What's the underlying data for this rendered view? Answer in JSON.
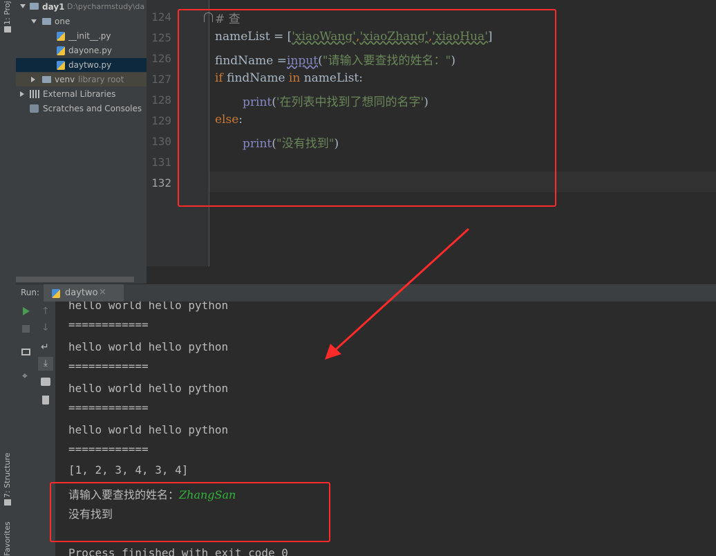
{
  "tool_windows": {
    "project_label": "1: Proj",
    "structure_label": "7: Structure",
    "favorites_label": "Favorites"
  },
  "project_tree": {
    "root_name": "day1",
    "root_path": "D:\\pycharmstudy\\da",
    "folder_one": "one",
    "files": [
      "__init__.py",
      "dayone.py",
      "daytwo.py"
    ],
    "venv_name": "venv",
    "venv_hint": "library root",
    "external_libraries": "External Libraries",
    "scratches": "Scratches and Consoles"
  },
  "editor": {
    "line_numbers": [
      "124",
      "125",
      "126",
      "127",
      "128",
      "129",
      "130",
      "131",
      "132"
    ],
    "line124": "# 查",
    "line125": {
      "var": "nameList = [",
      "s1": "'xiaoWang'",
      "c1": ",",
      "s2": "'xiaoZhang'",
      "c2": ",",
      "s3": "'xiaoHua'",
      "end": "]"
    },
    "line126": {
      "var": "findName =",
      "fn": "input",
      "open": "(",
      "s": "\"请输入要查找的姓名：\"",
      "close": ")"
    },
    "line127": {
      "kw1": "if",
      "mid": " findName ",
      "kw2": "in",
      "end": " nameList:"
    },
    "line128": {
      "fn": "print",
      "open": "(",
      "s": "'在列表中找到了想同的名字'",
      "close": ")"
    },
    "line129": {
      "kw": "else",
      "end": ":"
    },
    "line130": {
      "fn": "print",
      "open": "(",
      "s": "\"没有找到\"",
      "close": ")"
    }
  },
  "run": {
    "label": "Run:",
    "tab_name": "daytwo",
    "close_glyph": "×",
    "console_lines": [
      "hello world hello python",
      "============",
      "hello world hello python",
      "============",
      "hello world hello python",
      "============",
      "hello world hello python",
      "============",
      "[1, 2, 3, 4, 3, 4]"
    ],
    "prompt": "请输入要查找的姓名：",
    "user_input": "ZhangSan",
    "result": "没有找到",
    "exit_message": "Process finished with exit code 0"
  },
  "colors": {
    "annotation_red": "#ff2a2a",
    "input_green": "#2fb53a",
    "keyword": "#cc7832",
    "string": "#6a8759"
  }
}
